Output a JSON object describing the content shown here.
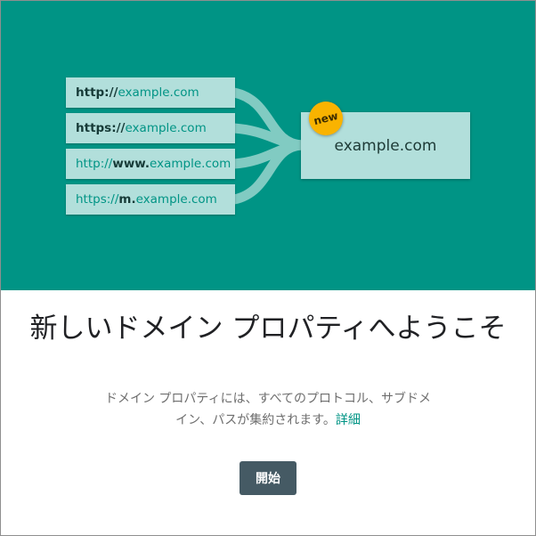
{
  "hero": {
    "urls": [
      {
        "scheme": "http://",
        "host_bold": "",
        "host": "example.com"
      },
      {
        "scheme": "https://",
        "host_bold": "",
        "host": "example.com"
      },
      {
        "scheme": "http://",
        "host_bold": "www.",
        "host": "example.com"
      },
      {
        "scheme": "https://",
        "host_bold": "m.",
        "host": "example.com"
      }
    ],
    "target": "example.com",
    "badge": "new"
  },
  "title": "新しいドメイン プロパティへようこそ",
  "description": {
    "text": "ドメイン プロパティには、すべてのプロトコル、サブドメイン、パスが集約されます。",
    "link": "詳細"
  },
  "start_button": "開始",
  "colors": {
    "hero_bg": "#009485",
    "box_bg": "#b2dfdb",
    "badge": "#f9b300",
    "button_bg": "#455a64"
  }
}
